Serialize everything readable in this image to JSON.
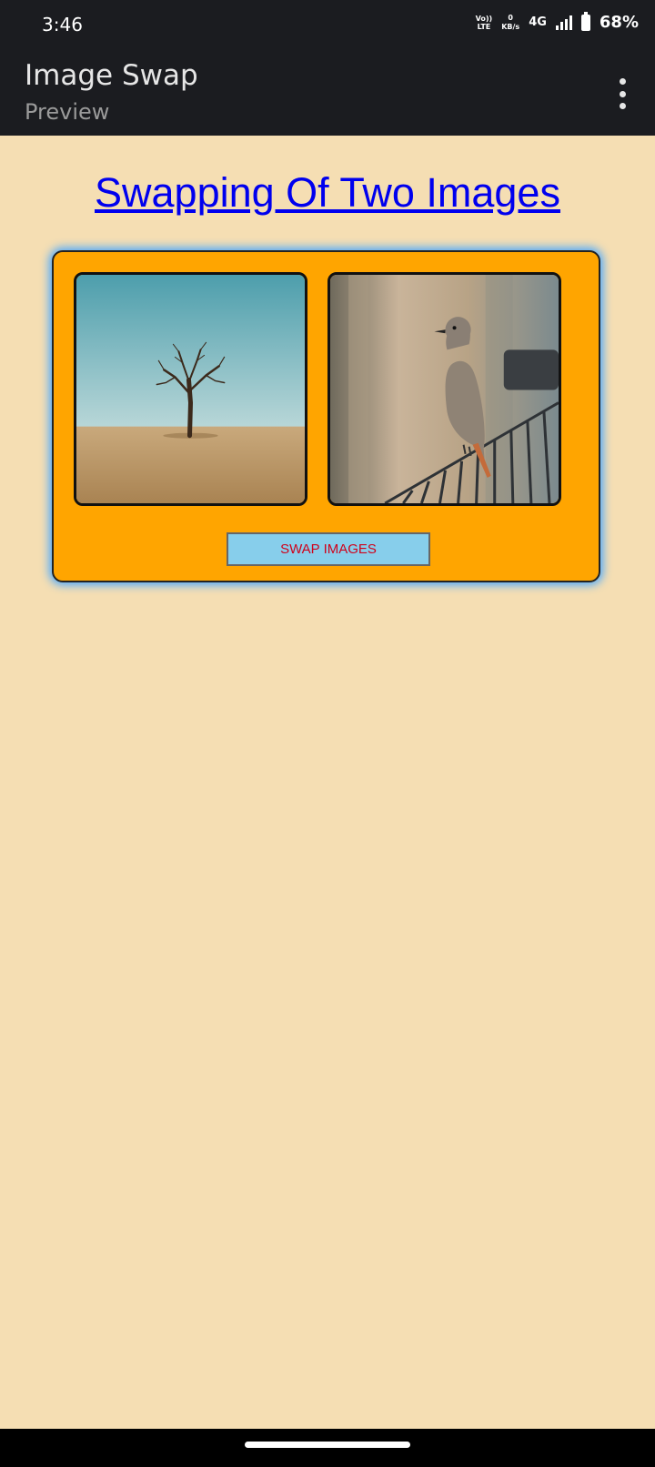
{
  "status_bar": {
    "time": "3:46",
    "volte_top": "Vo))",
    "volte_bottom": "LTE",
    "speed_value": "0",
    "speed_unit": "KB/s",
    "network": "4G",
    "battery": "68%"
  },
  "app_bar": {
    "title": "Image Swap",
    "subtitle": "Preview",
    "menu_icon": "more-vert-icon"
  },
  "main": {
    "heading": "Swapping Of Two Images",
    "images": [
      {
        "name": "tree-image",
        "subject": "bare tree in desert"
      },
      {
        "name": "bird-image",
        "subject": "bird on fence"
      }
    ],
    "swap_button_label": "SWAP IMAGES"
  },
  "colors": {
    "page_background": "#f5deb3",
    "card_background": "#ffa500",
    "heading_link": "#0000ee",
    "button_background": "#87ceeb",
    "button_text": "#d0021b",
    "card_glow": "#4aa8ff"
  }
}
